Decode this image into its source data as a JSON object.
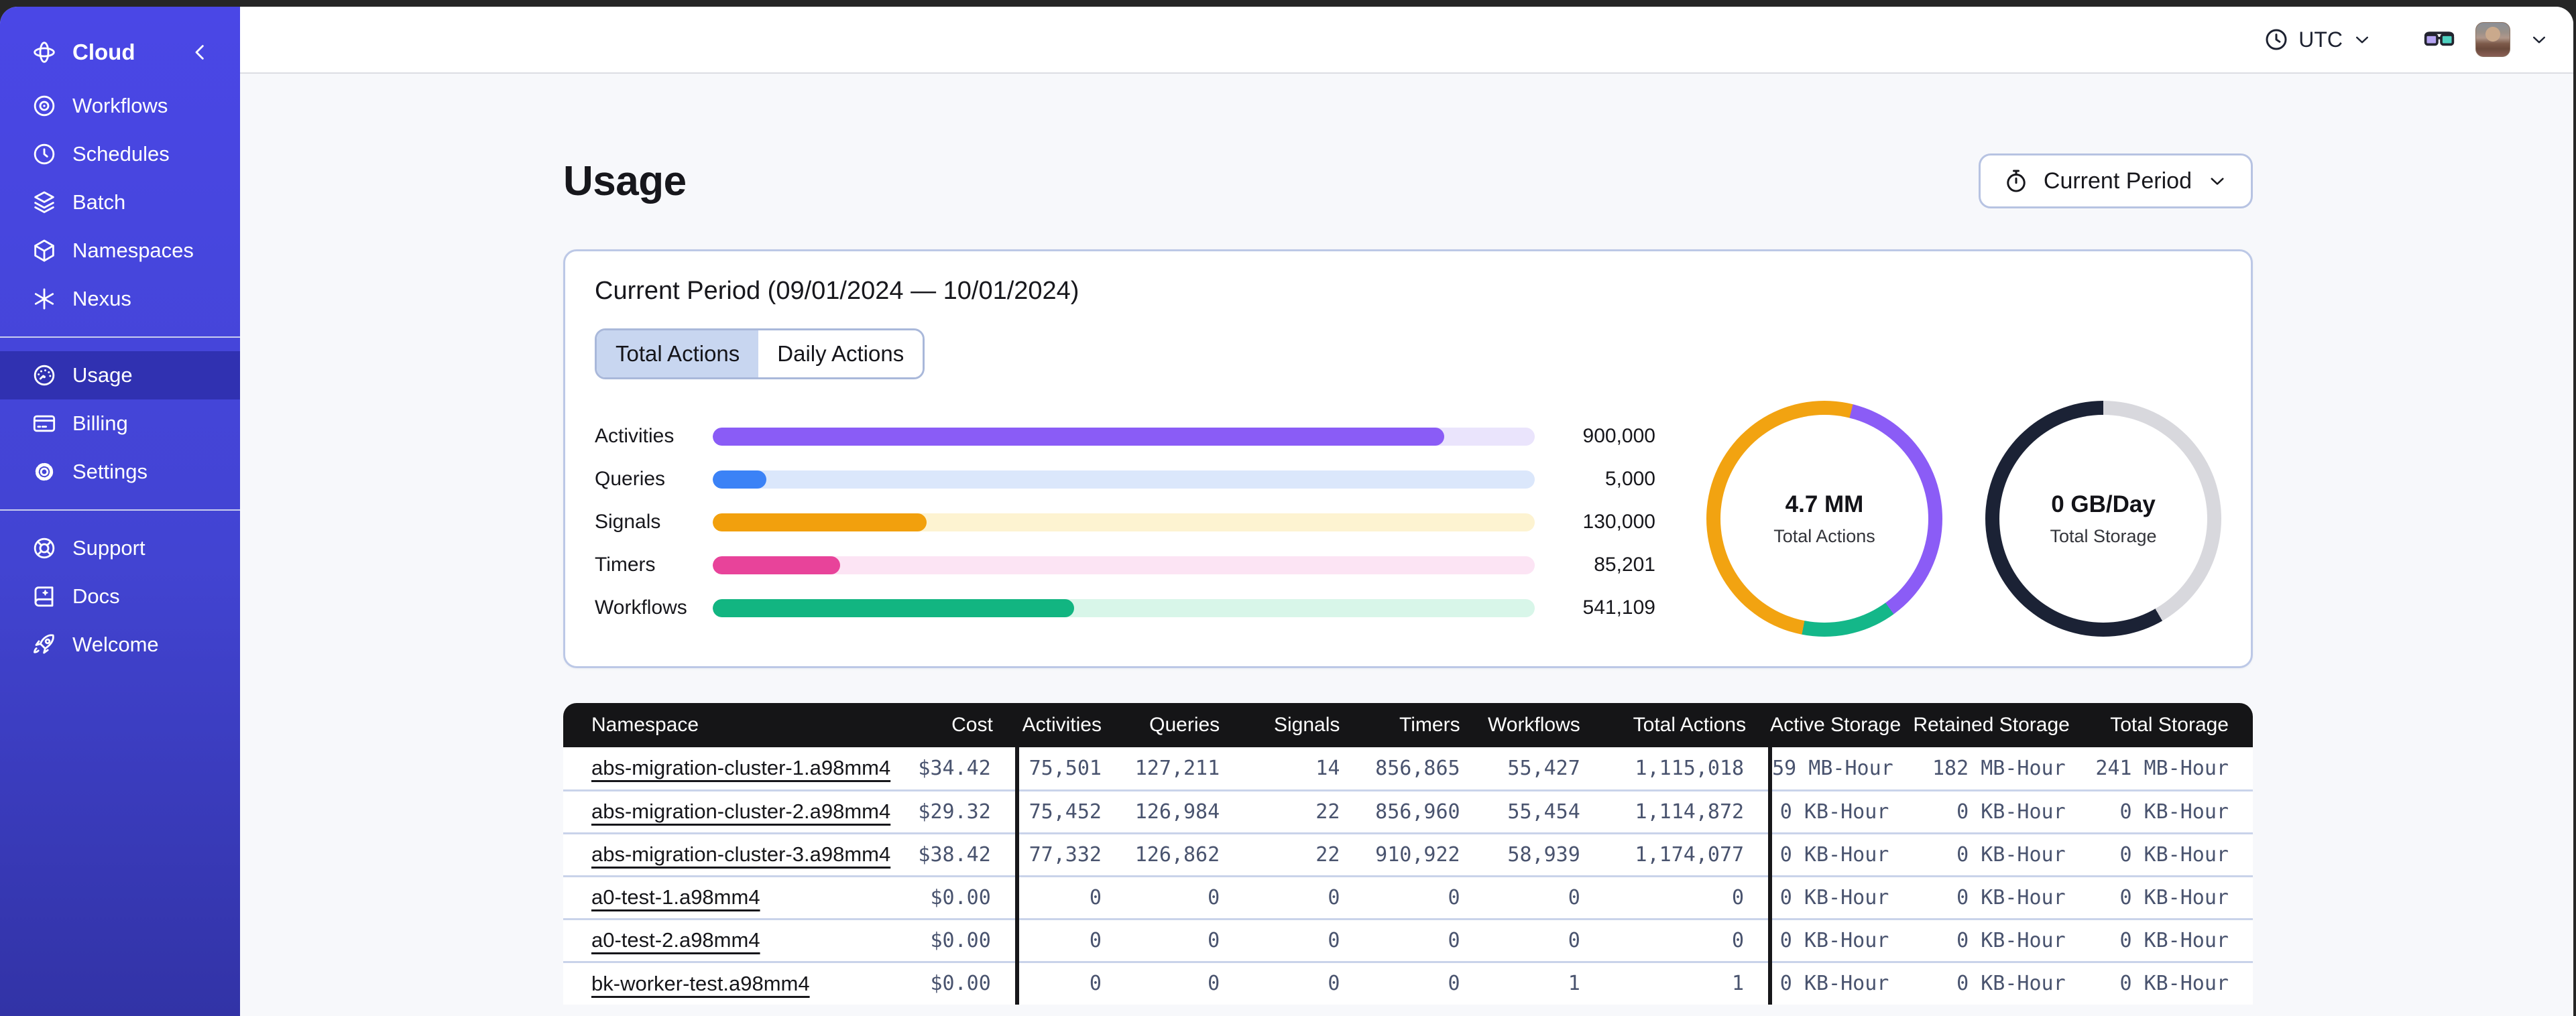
{
  "sidebar": {
    "header": {
      "label": "Cloud",
      "icon": "temporal-logo",
      "collapse_icon": "chevron-left"
    },
    "groups": [
      {
        "name": "primary",
        "items": [
          {
            "label": "Workflows",
            "icon": "workflows",
            "active": false
          },
          {
            "label": "Schedules",
            "icon": "schedules",
            "active": false
          },
          {
            "label": "Batch",
            "icon": "batch",
            "active": false
          },
          {
            "label": "Namespaces",
            "icon": "namespaces",
            "active": false
          },
          {
            "label": "Nexus",
            "icon": "nexus",
            "active": false
          }
        ]
      },
      {
        "name": "account",
        "items": [
          {
            "label": "Usage",
            "icon": "usage",
            "active": true
          },
          {
            "label": "Billing",
            "icon": "billing",
            "active": false
          },
          {
            "label": "Settings",
            "icon": "settings",
            "active": false
          }
        ]
      },
      {
        "name": "help",
        "items": [
          {
            "label": "Support",
            "icon": "support",
            "active": false
          },
          {
            "label": "Docs",
            "icon": "docs",
            "active": false
          },
          {
            "label": "Welcome",
            "icon": "welcome",
            "active": false
          }
        ]
      }
    ]
  },
  "topbar": {
    "timezone": {
      "icon": "clock",
      "label": "UTC",
      "chevron": "chevron-down"
    },
    "glasses_icon": "glasses",
    "user_menu": {
      "avatar": "user-photo",
      "chevron": "chevron-down"
    }
  },
  "page": {
    "title": "Usage",
    "period_selector": {
      "icon": "stopwatch",
      "label": "Current Period",
      "chevron": "chevron-down"
    }
  },
  "usage_card": {
    "title": "Current Period (09/01/2024 — 10/01/2024)",
    "tabs": [
      {
        "label": "Total Actions",
        "active": true
      },
      {
        "label": "Daily Actions",
        "active": false
      }
    ]
  },
  "chart_data": [
    {
      "type": "bar",
      "orientation": "horizontal",
      "categories": [
        "Activities",
        "Queries",
        "Signals",
        "Timers",
        "Workflows"
      ],
      "values": [
        900000,
        5000,
        130000,
        85201,
        541109
      ],
      "value_labels": [
        "900,000",
        "5,000",
        "130,000",
        "85,201",
        "541,109"
      ],
      "bar_colors": [
        "#8a5cf6",
        "#3b82f6",
        "#f2a00d",
        "#e8439a",
        "#12b581"
      ],
      "track_colors": [
        "#eae4fc",
        "#dbe7fb",
        "#fdf3d1",
        "#fce4f4",
        "#d8f6e9"
      ],
      "fill_fractions": [
        0.89,
        0.065,
        0.26,
        0.155,
        0.44
      ],
      "grid": false,
      "legend": false
    },
    {
      "type": "pie",
      "variant": "donut",
      "center_value": "4.7 MM",
      "center_label": "Total Actions",
      "start_angle_deg": 14,
      "segments": [
        {
          "name": "purple",
          "color": "#8b5cf6",
          "sweep_deg": 130,
          "share_pct": 36.1
        },
        {
          "name": "green",
          "color": "#14b789",
          "sweep_deg": 47,
          "share_pct": 13.1
        },
        {
          "name": "orange",
          "color": "#f2a311",
          "sweep_deg": 183,
          "share_pct": 50.8
        }
      ]
    },
    {
      "type": "pie",
      "variant": "donut",
      "center_value": "0 GB/Day",
      "center_label": "Total Storage",
      "start_angle_deg": 0,
      "segments": [
        {
          "name": "remaining",
          "color": "#d8d8dd",
          "sweep_deg": 150,
          "share_pct": 41.7
        },
        {
          "name": "used",
          "color": "#1b2235",
          "sweep_deg": 210,
          "share_pct": 58.3
        }
      ]
    }
  ],
  "table": {
    "columns": [
      {
        "label": "Namespace",
        "align": "left",
        "divider_after": false
      },
      {
        "label": "Cost",
        "align": "right",
        "divider_after": true
      },
      {
        "label": "Activities",
        "align": "right",
        "divider_after": false
      },
      {
        "label": "Queries",
        "align": "right",
        "divider_after": false
      },
      {
        "label": "Signals",
        "align": "right",
        "divider_after": false
      },
      {
        "label": "Timers",
        "align": "right",
        "divider_after": false
      },
      {
        "label": "Workflows",
        "align": "right",
        "divider_after": false
      },
      {
        "label": "Total Actions",
        "align": "right",
        "divider_after": true
      },
      {
        "label": "Active Storage",
        "align": "right",
        "divider_after": false
      },
      {
        "label": "Retained Storage",
        "align": "right",
        "divider_after": false
      },
      {
        "label": "Total Storage",
        "align": "right",
        "divider_after": false
      }
    ],
    "rows": [
      [
        "abs-migration-cluster-1.a98mm4",
        "$34.42",
        "75,501",
        "127,211",
        "14",
        "856,865",
        "55,427",
        "1,115,018",
        "59 MB-Hour",
        "182 MB-Hour",
        "241 MB-Hour"
      ],
      [
        "abs-migration-cluster-2.a98mm4",
        "$29.32",
        "75,452",
        "126,984",
        "22",
        "856,960",
        "55,454",
        "1,114,872",
        "0 KB-Hour",
        "0 KB-Hour",
        "0 KB-Hour"
      ],
      [
        "abs-migration-cluster-3.a98mm4",
        "$38.42",
        "77,332",
        "126,862",
        "22",
        "910,922",
        "58,939",
        "1,174,077",
        "0 KB-Hour",
        "0 KB-Hour",
        "0 KB-Hour"
      ],
      [
        "a0-test-1.a98mm4",
        "$0.00",
        "0",
        "0",
        "0",
        "0",
        "0",
        "0",
        "0 KB-Hour",
        "0 KB-Hour",
        "0 KB-Hour"
      ],
      [
        "a0-test-2.a98mm4",
        "$0.00",
        "0",
        "0",
        "0",
        "0",
        "0",
        "0",
        "0 KB-Hour",
        "0 KB-Hour",
        "0 KB-Hour"
      ],
      [
        "bk-worker-test.a98mm4",
        "$0.00",
        "0",
        "0",
        "0",
        "0",
        "1",
        "1",
        "0 KB-Hour",
        "0 KB-Hour",
        "0 KB-Hour"
      ]
    ]
  },
  "theme": {
    "sidebar_top": "#4a47e6",
    "sidebar_bottom": "#3233a6",
    "sidebar_selected": "#3a3cb2",
    "selected_tab_bg": "#c8d6f0",
    "card_border": "#bcc8e6",
    "table_header_bg": "#151517",
    "table_row_text": "#49536e",
    "row_divider": "#c9d3ea"
  }
}
